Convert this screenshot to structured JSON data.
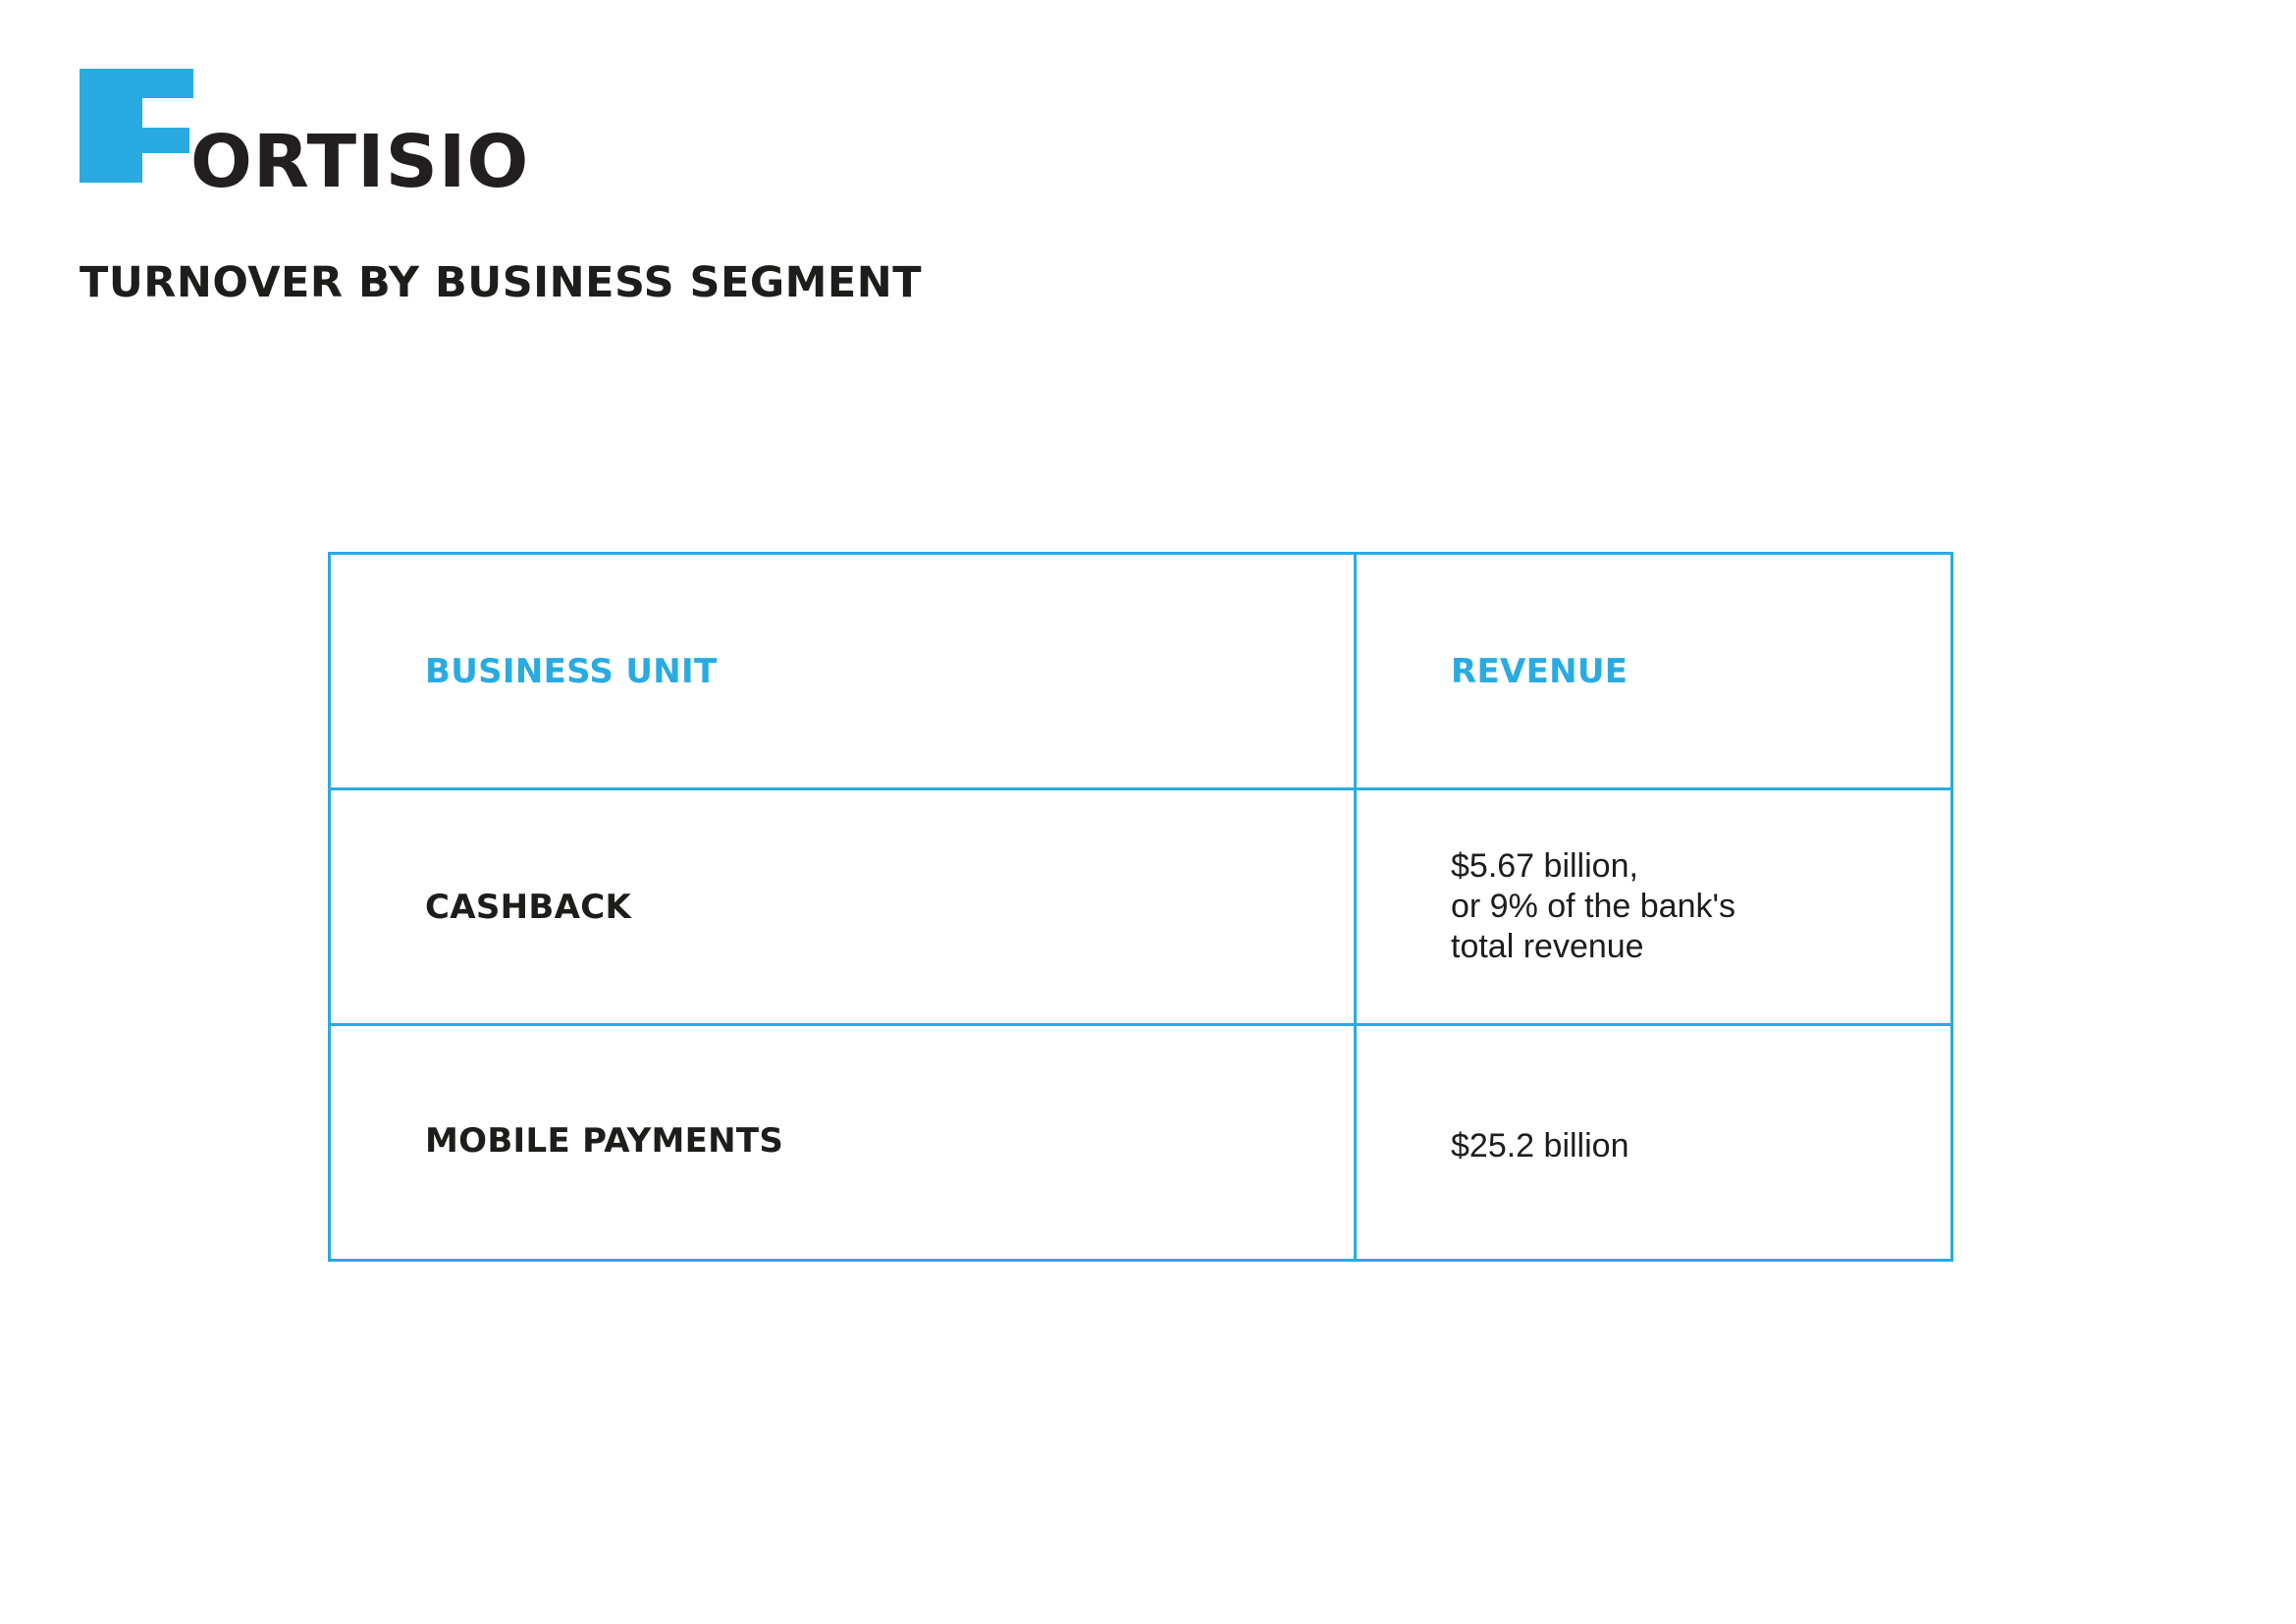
{
  "brand": {
    "name_first_letter": "F",
    "name_rest": "ORTISIO",
    "accent_color": "#29abe2",
    "text_color": "#1d1d1b",
    "icon": "fortisio-f-logo-icon"
  },
  "page": {
    "title": "TURNOVER BY BUSINESS SEGMENT"
  },
  "table": {
    "headers": {
      "business_unit": "BUSINESS UNIT",
      "revenue": "REVENUE"
    },
    "rows": [
      {
        "business_unit": "CASHBACK",
        "revenue_lines": [
          "$5.67 billion,",
          "or 9% of the bank's",
          "total revenue"
        ]
      },
      {
        "business_unit": "MOBILE PAYMENTS",
        "revenue_lines": [
          "$25.2 billion"
        ]
      }
    ]
  }
}
